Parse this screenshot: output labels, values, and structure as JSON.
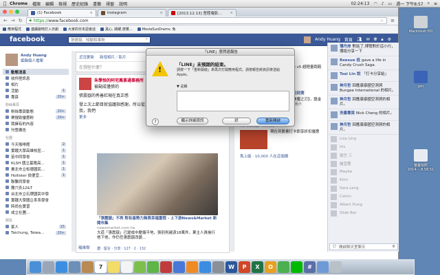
{
  "menubar": {
    "app": "Chrome",
    "items": [
      "檔案",
      "編輯",
      "檢視",
      "歷史紀錄",
      "書籤",
      "視窗",
      "說明"
    ],
    "time_left": "02:24:13",
    "clock": "週一 下午8:57"
  },
  "desktop": {
    "icons": [
      {
        "label": "Macintosh HD",
        "color": "#cfd3d8"
      },
      {
        "label": "pm",
        "color": "#3b63b8"
      },
      {
        "label": "螢幕快照 2014-...8.58.51",
        "color": "#e8ecf2"
      }
    ]
  },
  "browser": {
    "tabs": [
      {
        "label": "(1) Facebook",
        "color": "#3b5998"
      },
      {
        "label": "Instagram",
        "color": "#6b4a32"
      },
      {
        "label": "[2013.12.13] 吾陸電影...",
        "color": "#cc0000"
      }
    ],
    "url_scheme": "https://",
    "url_host": "www.facebook.com",
    "bookmarks": [
      "應用程式",
      "連續劇吧打入日劇",
      "大家的日本語會話",
      "黑心, 跳躍,感覺...",
      "MovieSunDramv. 免"
    ]
  },
  "facebook": {
    "logo": "facebook",
    "search_placeholder": "張震嶽，知動和事物",
    "user_name": "Andy Huang",
    "home": "首頁",
    "profile": {
      "name": "Andy Huang",
      "edit": "編輯個人檔案"
    },
    "nav": [
      {
        "label": "動態消息",
        "count": ""
      },
      {
        "label": "收件匣訊息",
        "count": ""
      },
      {
        "label": "相片",
        "count": ""
      },
      {
        "label": "活動",
        "count": "1"
      },
      {
        "label": "專頁",
        "count": "20+"
      }
    ],
    "section_pages": "粉絲專頁",
    "pages": [
      {
        "label": "粉絲專頁動態",
        "count": "20+"
      },
      {
        "label": "樂搜勁優惠粉",
        "count": "20+"
      },
      {
        "label": "我擁有的內容",
        "count": ""
      },
      {
        "label": "刊登廣告",
        "count": ""
      }
    ],
    "section_groups": "社團",
    "groups": [
      {
        "label": "今天咖啡館",
        "count": "2"
      },
      {
        "label": "實踐大學高雄校區...",
        "count": "1"
      },
      {
        "label": "苗中同學會",
        "count": "1"
      },
      {
        "label": "KLSH 國立基隆高...",
        "count": "1"
      },
      {
        "label": "臺北市立松德國民...",
        "count": "1"
      },
      {
        "label": "Hollister 撿便宜...",
        "count": "1"
      },
      {
        "label": "聯繫同學會",
        "count": ""
      },
      {
        "label": "撒穴灸12&T",
        "count": ""
      },
      {
        "label": "台北市立石牌國民中學",
        "count": ""
      },
      {
        "label": "實踐大學國企系系學會",
        "count": ""
      },
      {
        "label": "時尚在實習",
        "count": ""
      },
      {
        "label": "成立社團...",
        "count": ""
      }
    ],
    "section_friends": "朋友",
    "friends": [
      {
        "label": "家人",
        "count": "15"
      },
      {
        "label": "Taichung, Taiwa...",
        "count": "20+"
      }
    ],
    "composer_tabs": [
      "近況更新",
      "新增相片／影片"
    ],
    "composer_placeholder": "在想些什麼？",
    "story": {
      "author": "朱學恒的阿宅萬事通事務所",
      "headline": "被副成僅張的",
      "para1": "張震嶽的秀善紅現在真正感",
      "para2": "發上次上節目就協議指感謝，所以從上衣要的但我鄧安是問題。我們覺忙事學我，我們",
      "more": "更多",
      "caption_title": "「張震嶽」不再 對有善勢力無畏幸福重程 - 上下游News&Market 新聞市集",
      "caption_src": "newsmarket.com.tw",
      "caption_body": "大道「張震嶽」已變成中壓傷平地，張別刑越淚18萬件，果主人員後行他下他，作仍任張震嶽改變…",
      "actions": "讚 · 留言 · 分享 · 127 · 2 · 132",
      "bottom_author": "羅維樹"
    }
  },
  "right_col": {
    "ads": [
      {
        "title": "【NIKE】優惠價$1390",
        "src": "brand-ave.shop.rakuten.tw",
        "desc": "NIKE Free 3.0 v5 超輕量跑鞋",
        "color": "#2a6fc4"
      },
      {
        "title": "跨世神獸狂侍，《鬥戰聖佛》今日封測",
        "src": "",
        "desc": "全東方血戰【神魔之刃】，獎金總額 100,000元!!",
        "color": "#6b3b1e"
      },
      {
        "title": "九州鍋餐廳－麻辣鍋",
        "src": "",
        "desc": "現在到臉書打卡即享折扣優惠",
        "color": "#b8432b"
      }
    ],
    "likes": "馬上能 · 10,000 人在這個讚"
  },
  "chat": {
    "ticker": [
      {
        "name": "薄丹岸",
        "text": "對話了,博覽對於這小行，傳說分享一下"
      },
      {
        "name": "Beesue 投",
        "text": "gave a life in Candy Crush Saga."
      },
      {
        "name": "Tsai Lin 說",
        "text": "「打卡分享給」"
      },
      {
        "name": "神月哲",
        "text": "回應康康國空洞洞 Bungee International 的相片。"
      },
      {
        "name": "神月哲",
        "text": "回應康康國空洞洞的相片。"
      },
      {
        "name": "洗書專頁",
        "text": "Nick Cheng 的相片。"
      },
      {
        "name": "神月哲",
        "text": "回應康康國空洞洞的相片。"
      }
    ],
    "buddies": [
      "Lisa Ling",
      "Iris",
      "尾巴 三",
      "施宜蓉",
      "Maybe",
      "Kimi",
      "Sara Leng",
      "Calvin",
      "Albert Hung",
      "Slide Bar"
    ],
    "search": "開啟聊天室聊天"
  },
  "dialog": {
    "window_title": "「LINE」意閃退報告",
    "title": "「LINE」未預期的結束。",
    "message": "請按一下「重新開啟」來再次打開應用程式。請按報告將資訊寄送給 Apple。",
    "report_label": "註解",
    "btn_details": "顯示詳細資訊",
    "btn_ok": "好",
    "btn_reopen": "重新開啟"
  },
  "dock": [
    {
      "name": "finder",
      "color": "#4a8fd8",
      "glyph": ""
    },
    {
      "name": "launchpad",
      "color": "#9aa6b8",
      "glyph": ""
    },
    {
      "name": "safari",
      "color": "#3c8fe0",
      "glyph": ""
    },
    {
      "name": "mail",
      "color": "#6c8fb8",
      "glyph": ""
    },
    {
      "name": "contacts",
      "color": "#b98a52",
      "glyph": ""
    },
    {
      "name": "calendar",
      "color": "#ffffff",
      "glyph": "7"
    },
    {
      "name": "notes",
      "color": "#f3dc67",
      "glyph": ""
    },
    {
      "name": "reminders",
      "color": "#f4f4f4",
      "glyph": ""
    },
    {
      "name": "messages",
      "color": "#7dbf4c",
      "glyph": ""
    },
    {
      "name": "facetime",
      "color": "#5eb548",
      "glyph": ""
    },
    {
      "name": "photobooth",
      "color": "#c03c3c",
      "glyph": ""
    },
    {
      "name": "itunes",
      "color": "#4878d8",
      "glyph": ""
    },
    {
      "name": "ibooks",
      "color": "#f08a24",
      "glyph": ""
    },
    {
      "name": "appstore",
      "color": "#3a8de0",
      "glyph": ""
    },
    {
      "name": "preferences",
      "color": "#8a8f98",
      "glyph": ""
    },
    {
      "name": "word",
      "color": "#2b579a",
      "glyph": "W"
    },
    {
      "name": "powerpoint",
      "color": "#d24726",
      "glyph": "P"
    },
    {
      "name": "excel",
      "color": "#217346",
      "glyph": "X"
    },
    {
      "name": "outlook",
      "color": "#e8a020",
      "glyph": "O"
    },
    {
      "name": "chrome",
      "color": "#4caf50",
      "glyph": ""
    },
    {
      "name": "line",
      "color": "#00b900",
      "glyph": ""
    },
    {
      "name": "other",
      "color": "#5a6ea8",
      "glyph": "#"
    },
    {
      "name": "folder",
      "color": "#6e9bd6",
      "glyph": ""
    },
    {
      "name": "trash",
      "color": "#b9c0c8",
      "glyph": ""
    }
  ]
}
